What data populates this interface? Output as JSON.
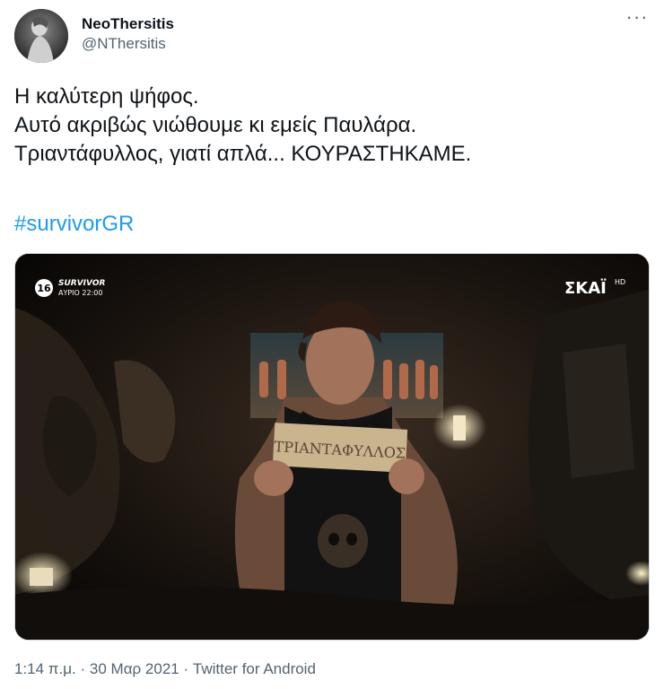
{
  "tweet": {
    "display_name": "NeoThersitis",
    "handle": "@NThersitis",
    "more_icon": "more-horizontal-icon",
    "text_lines": [
      "Η καλύτερη ψήφος.",
      "Αυτό ακριβώς νιώθουμε κι εμείς Παυλάρα.",
      "Τριαντάφυλλος, γιατί απλά... ΚΟΥΡΑΣΤΗΚΑΜΕ."
    ],
    "hashtag": "#survivorGR",
    "media": {
      "age_rating": "16",
      "show_title": "SURVIVOR",
      "show_time": "ΑΥΡΙΟ 22:00",
      "channel_logo": "ΣΚΑΪ",
      "channel_hd": "HD",
      "sign_text": "ΤΡΙΑΝΤΑΦΥΛΛΟΣ"
    },
    "time": "1:14 π.μ.",
    "date": "30 Μαρ 2021",
    "source": "Twitter for Android",
    "separator": "·",
    "colors": {
      "link": "#1d9bf0",
      "secondary": "#536471",
      "text": "#0f1419"
    }
  }
}
